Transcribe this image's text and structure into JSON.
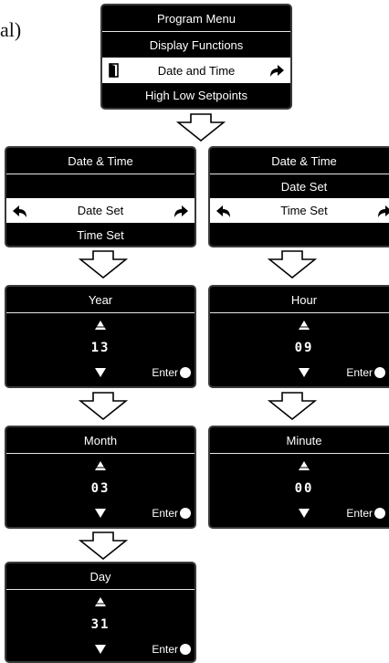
{
  "left_fragment": "al)",
  "program_menu": {
    "title": "Program Menu",
    "items": [
      "Display Functions",
      "Date and Time",
      "High Low Setpoints"
    ]
  },
  "date_time_a": {
    "title": "Date & Time",
    "items": [
      "",
      "Date Set",
      "Time Set"
    ]
  },
  "date_time_b": {
    "title": "Date & Time",
    "items": [
      "Date Set",
      "Time Set"
    ]
  },
  "year": {
    "title": "Year",
    "value": "13",
    "enter_label": "Enter"
  },
  "hour": {
    "title": "Hour",
    "value": "09",
    "enter_label": "Enter"
  },
  "month": {
    "title": "Month",
    "value": "03",
    "enter_label": "Enter"
  },
  "minute": {
    "title": "Minute",
    "value": "00",
    "enter_label": "Enter"
  },
  "day": {
    "title": "Day",
    "value": "31",
    "enter_label": "Enter"
  },
  "icons": {
    "selected_row_left": "door-exit-icon",
    "selected_row_right": "curved-arrow-right-icon",
    "back": "curved-arrow-left-icon",
    "forward": "curved-arrow-right-icon",
    "up": "triangle-up-icon",
    "down": "triangle-down-icon",
    "enter": "filled-circle-icon",
    "flow": "hollow-arrow-down-icon"
  },
  "colors": {
    "screen_bg": "#000000",
    "screen_text": "#ffffff",
    "selection_bg": "#ffffff",
    "selection_text": "#000000"
  }
}
